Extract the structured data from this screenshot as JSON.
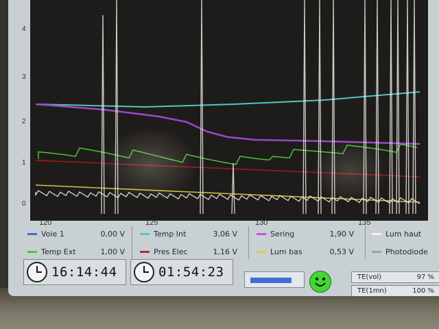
{
  "plot": {
    "y_ticks": [
      "0",
      "1",
      "2",
      "3",
      "4"
    ],
    "x_ticks": [
      "120",
      "125",
      "130",
      "135"
    ],
    "background": "#1e1c1a",
    "traces": {
      "voie1_color": "#e9e7e0",
      "temp_int_color": "#4ec7c2",
      "sering_color": "#9a49c8",
      "temp_ext_color": "#4bc43c",
      "pres_elec_color": "#b11a1e",
      "lum_bas_color": "#d6c43a"
    }
  },
  "legend": {
    "col1": [
      {
        "label": "Voie 1",
        "value": "0,00 V",
        "color": "#3d6fd6"
      },
      {
        "label": "Temp Ext",
        "value": "1,00 V",
        "color": "#4bc43c"
      }
    ],
    "col2": [
      {
        "label": "Temp Int",
        "value": "3,06 V",
        "color": "#4ec7c2"
      },
      {
        "label": "Pres Elec",
        "value": "1,16 V",
        "color": "#c0262b"
      }
    ],
    "col3": [
      {
        "label": "Sering",
        "value": "1,90 V",
        "color": "#c455d8"
      },
      {
        "label": "Lum bas",
        "value": "0,53 V",
        "color": "#d6d23a"
      }
    ],
    "col4": [
      {
        "label": "Lum haut",
        "color": "#f2f2f2"
      },
      {
        "label": "Photodiode",
        "color": "#9aa2a6"
      }
    ]
  },
  "clock": {
    "time": "16:14:44",
    "icon": "clock-icon"
  },
  "timer": {
    "elapsed": "01:54:23",
    "icon": "stopwatch-icon"
  },
  "progress": {
    "fraction": 0.85,
    "color": "#3d6fd6"
  },
  "status_icon": "smiley-icon",
  "te": [
    {
      "label": "TE(vol)",
      "value": "97 %"
    },
    {
      "label": "TE(1mn)",
      "value": "100 %"
    }
  ]
}
